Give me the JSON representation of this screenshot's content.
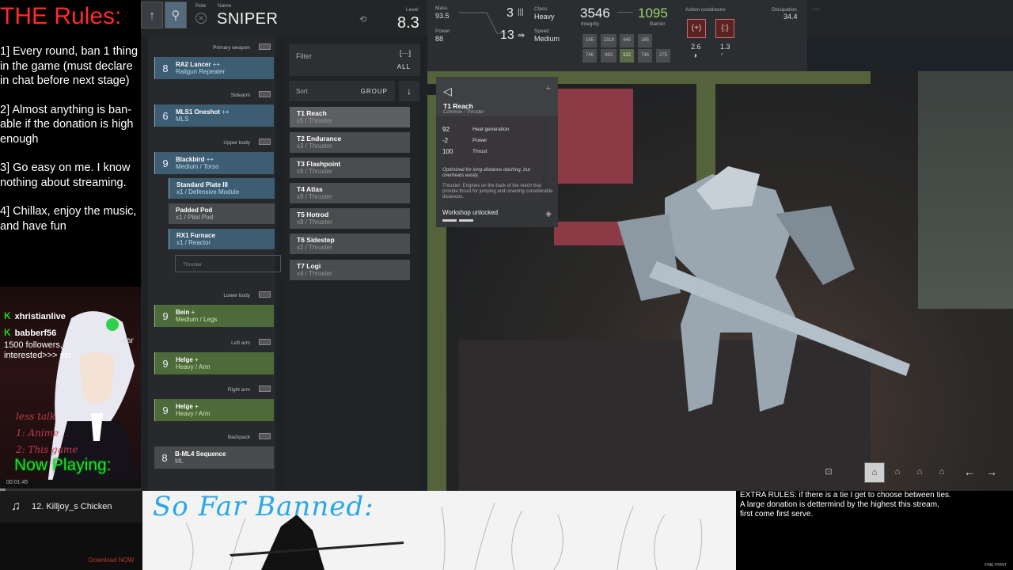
{
  "rules_panel": {
    "title": "THE Rules:",
    "rules": [
      "1]  Every round, ban 1 thing in the game (must declare in chat before next stage)",
      "2]  Almost anything is ban-able if the donation is high enough",
      "3]  Go easy on me. I know nothing about streaming.",
      "4] Chillax, enjoy the music, and have fun"
    ]
  },
  "chat": {
    "messages": [
      {
        "user": "xhristianlive",
        "text": ""
      },
      {
        "user": "babberf56",
        "text": "i car"
      }
    ],
    "extra_text": "1500 followers,\ninterested>>> sin",
    "notes": [
      "less talk",
      "1: Anime",
      "2: This game"
    ],
    "now_playing": "Now Playing:"
  },
  "player": {
    "elapsed": "00:01:45",
    "progress": 0.04,
    "track": "12. Killjoy_s Chicken"
  },
  "header": {
    "role_label": "Role",
    "name_label": "Name",
    "name": "SNIPER",
    "level_label": "Level",
    "level": "8.3",
    "mass_label": "Mass",
    "mass": "93.5",
    "power_label": "Power",
    "power": "88",
    "class_val": "3",
    "class_label": "Class",
    "class": "Heavy",
    "speed_val": "13",
    "speed_label": "Speed",
    "speed": "Medium",
    "integrity": "3546",
    "integrity_label": "Integrity",
    "barrier": "1095",
    "barrier_label": "Barrier",
    "integrity_grid": [
      "165",
      "1319",
      "445",
      "165",
      "746",
      "463",
      "322",
      "746",
      "275"
    ],
    "cooldown_label": "Action cooldowns",
    "cooldowns": [
      "2.6",
      "1.3"
    ],
    "dissipation_label": "Dissipation",
    "dissipation": "34.4",
    "more": "···"
  },
  "parts": {
    "groups": {
      "primary": "Primary weapon",
      "sidearm": "Sidearm",
      "upper": "Upper body",
      "lower": "Lower body",
      "left_arm": "Left arm",
      "right_arm": "Right arm",
      "backpack": "Backpack"
    },
    "primary": {
      "lvl": "8",
      "name": "RA2 Lancer",
      "plus": "++",
      "sub": "Railgun Repeater"
    },
    "sidearm": {
      "lvl": "6",
      "name": "MLS1 Oneshot",
      "plus": "++",
      "sub": "MLS"
    },
    "upper": {
      "lvl": "9",
      "name": "Blackbird",
      "plus": "++",
      "sub": "Medium / Torso"
    },
    "modules": [
      {
        "name": "Standard Plate III",
        "sub": "x1 / Defensive Module"
      },
      {
        "name": "Padded Pod",
        "sub": "x1 / Pilot Pod"
      },
      {
        "name": "RX1 Furnace",
        "sub": "x1 / Reactor"
      }
    ],
    "empty_slot": "Thruster",
    "lower": {
      "lvl": "9",
      "name": "Bein",
      "plus": "+",
      "sub": "Medium / Legs"
    },
    "left_arm": {
      "lvl": "9",
      "name": "Helge",
      "plus": "+",
      "sub": "Heavy / Arm"
    },
    "right_arm": {
      "lvl": "9",
      "name": "Helge",
      "plus": "+",
      "sub": "Heavy / Arm"
    },
    "backpack": {
      "lvl": "8",
      "name": "B-ML4 Sequence",
      "sub": "ML"
    }
  },
  "filter": {
    "label": "Filter",
    "icon": "[···]",
    "all": "ALL",
    "sort_label": "Sort",
    "sort_group": "GROUP",
    "items": [
      {
        "name": "T1 Reach",
        "sub": "x5 / Thruster"
      },
      {
        "name": "T2 Endurance",
        "sub": "x3 / Thruster"
      },
      {
        "name": "T3 Flashpoint",
        "sub": "x9 / Thruster"
      },
      {
        "name": "T4 Atlas",
        "sub": "x9 / Thruster"
      },
      {
        "name": "T5 Hotrod",
        "sub": "x8 / Thruster"
      },
      {
        "name": "T6 Sidestep",
        "sub": "x2 / Thruster"
      },
      {
        "name": "T7 Logi",
        "sub": "x4 / Thruster"
      }
    ]
  },
  "tooltip": {
    "name": "T1 Reach",
    "sub": "Common / Thruster",
    "stats": [
      {
        "v": "92",
        "l": "Heat generation"
      },
      {
        "v": "-2",
        "l": "Power"
      },
      {
        "v": "100",
        "l": "Thrust"
      }
    ],
    "desc": "Optimized for long-distance dashing, but overheats easily.",
    "desc2": "Thruster: Engines on the back of the mech that provide thrust for jumping and covering considerable distances.",
    "workshop": "Workshop unlocked"
  },
  "overlay": {
    "banned_title": "So Far Banned:",
    "extra_rules": [
      "EXTRA RULES:    if there is a tie I get to choose between ties.",
      "A large donation is dettermind by the highest this stream,",
      "first come first serve."
    ],
    "fine_print": "FINE PRINT",
    "download": "Download NOW"
  },
  "colors": {
    "rules_title": "#ff2a2a",
    "now_playing": "#19e326",
    "banned": "#29a8e8",
    "accent_blue": "#3d5d72",
    "accent_green": "#4d6a3a"
  }
}
